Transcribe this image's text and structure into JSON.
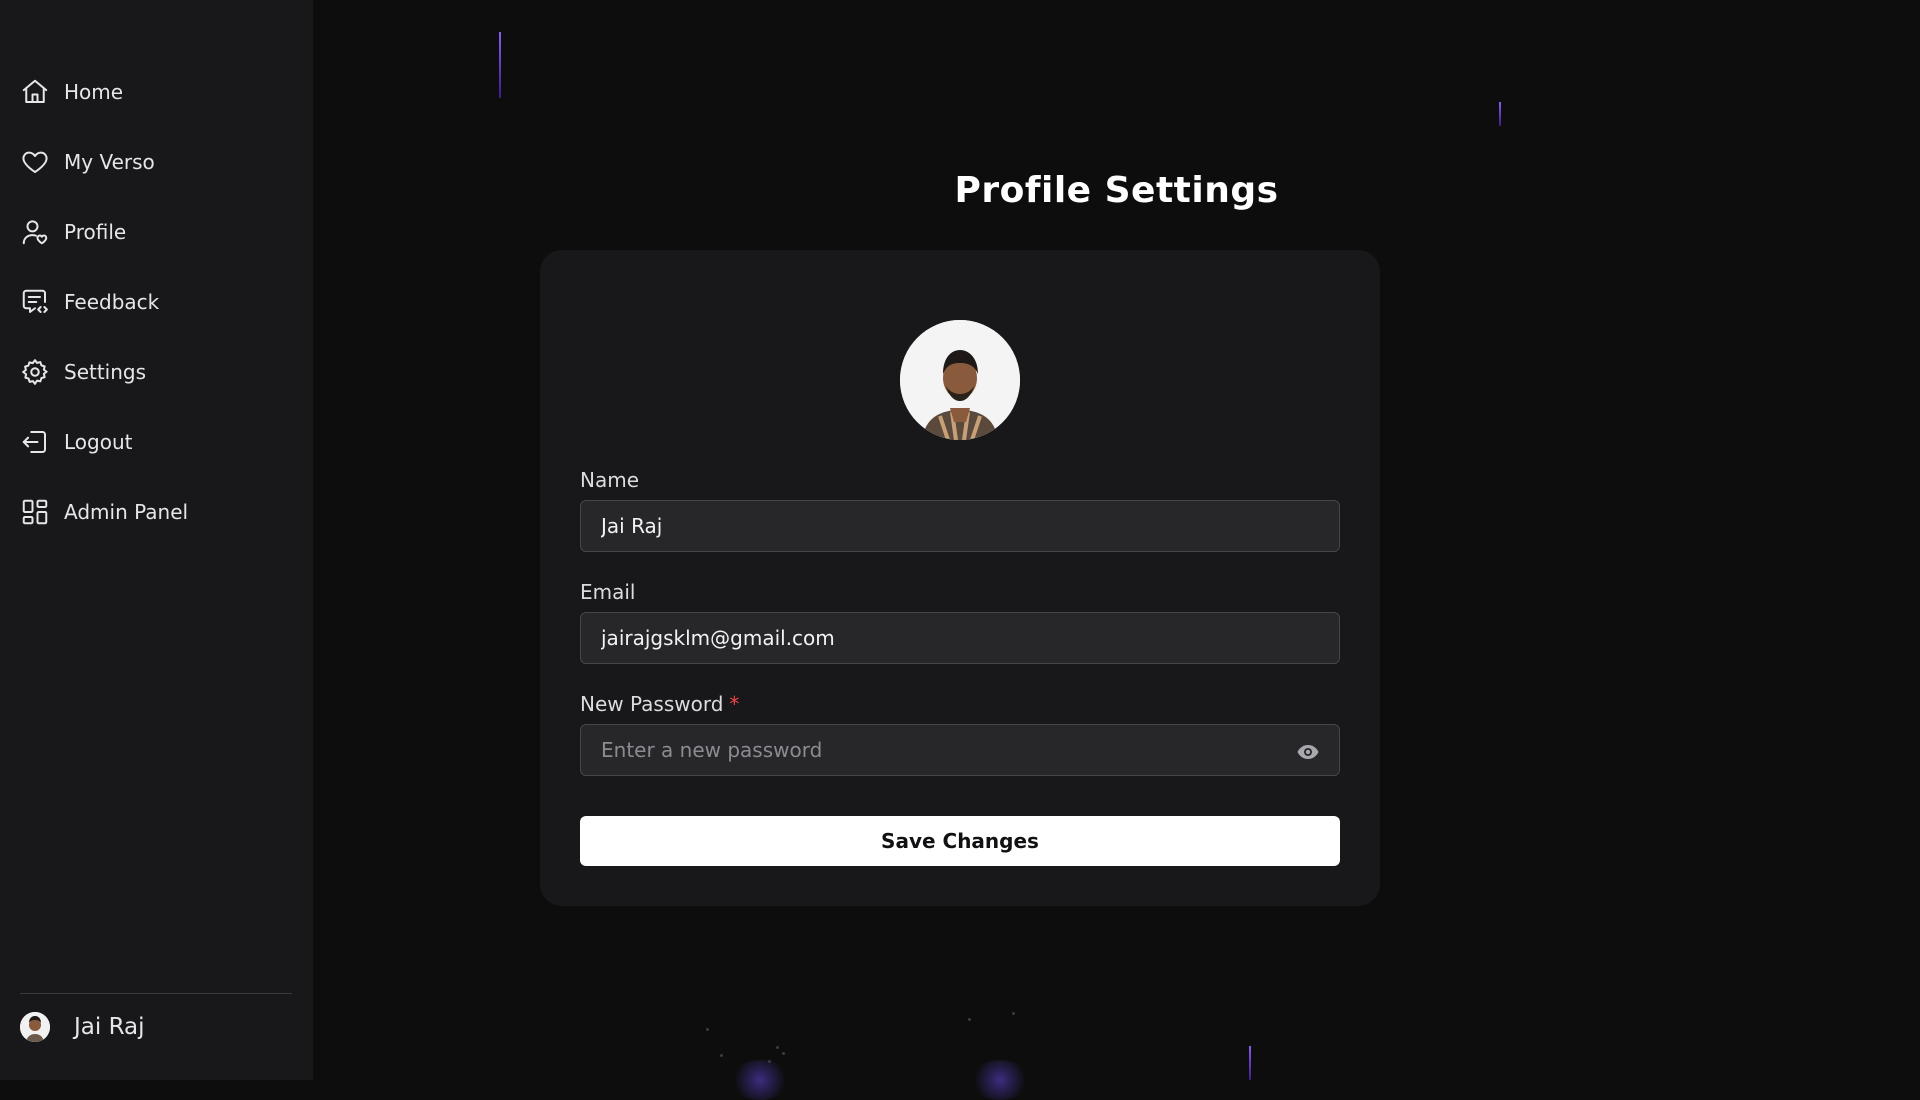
{
  "sidebar": {
    "items": [
      {
        "label": "Home",
        "icon": "home-icon"
      },
      {
        "label": "My Verso",
        "icon": "heart-icon"
      },
      {
        "label": "Profile",
        "icon": "user-heart-icon"
      },
      {
        "label": "Feedback",
        "icon": "message-code-icon"
      },
      {
        "label": "Settings",
        "icon": "gear-icon"
      },
      {
        "label": "Logout",
        "icon": "logout-icon"
      },
      {
        "label": "Admin Panel",
        "icon": "grid-icon"
      }
    ],
    "user": {
      "name": "Jai Raj"
    }
  },
  "page": {
    "title": "Profile Settings"
  },
  "form": {
    "name_label": "Name",
    "name_value": "Jai Raj",
    "email_label": "Email",
    "email_value": "jairajgsklm@gmail.com",
    "password_label": "New Password",
    "password_required_mark": "*",
    "password_placeholder": "Enter a new password",
    "save_label": "Save Changes"
  },
  "colors": {
    "background": "#0d0d0e",
    "sidebar": "#18181b",
    "card": "#18181b",
    "input": "#27272a",
    "accent_streak": "#8b5cf6",
    "required": "#ef4444",
    "button": "#ffffff"
  }
}
